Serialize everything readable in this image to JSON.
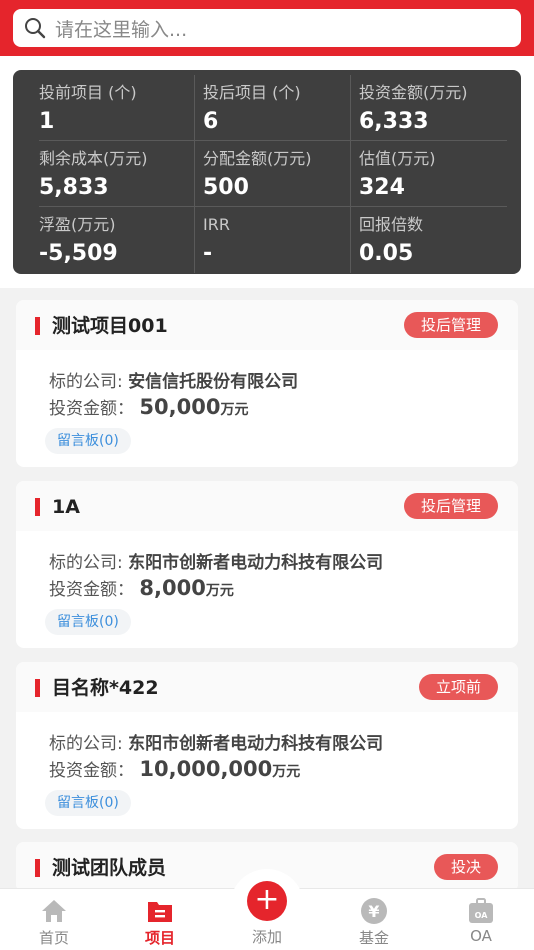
{
  "search": {
    "placeholder": "请在这里输入..."
  },
  "stats": [
    {
      "label": "投前项目 (个)",
      "value": "1"
    },
    {
      "label": "投后项目 (个)",
      "value": "6"
    },
    {
      "label": "投资金额(万元)",
      "value": "6,333"
    },
    {
      "label": "剩余成本(万元)",
      "value": "5,833"
    },
    {
      "label": "分配金额(万元)",
      "value": "500"
    },
    {
      "label": "估值(万元)",
      "value": "324"
    },
    {
      "label": "浮盈(万元)",
      "value": "-5,509"
    },
    {
      "label": "IRR",
      "value": "-"
    },
    {
      "label": "回报倍数",
      "value": "0.05"
    }
  ],
  "labels": {
    "company": "标的公司:",
    "amount": "投资金额：",
    "unit": "万元",
    "board": "留言板(0)"
  },
  "projects": [
    {
      "title": "测试项目001",
      "status": "投后管理",
      "company": "安信信托股份有限公司",
      "amount": "50,000"
    },
    {
      "title": "1A",
      "status": "投后管理",
      "company": "东阳市创新者电动力科技有限公司",
      "amount": "8,000"
    },
    {
      "title": "目名称*422",
      "status": "立项前",
      "company": "东阳市创新者电动力科技有限公司",
      "amount": "10,000,000"
    },
    {
      "title": "测试团队成员",
      "status": "投决"
    }
  ],
  "tabbar": {
    "home": "首页",
    "projects": "项目",
    "add_symbol": "+",
    "add": "添加",
    "fund": "基金",
    "fund_symbol": "¥",
    "oa": "OA",
    "oa_symbol": "OA"
  },
  "colors": {
    "brand": "#e5252c",
    "badge": "#e85858",
    "panel": "#3f3f3f",
    "link": "#3d8fdc"
  }
}
